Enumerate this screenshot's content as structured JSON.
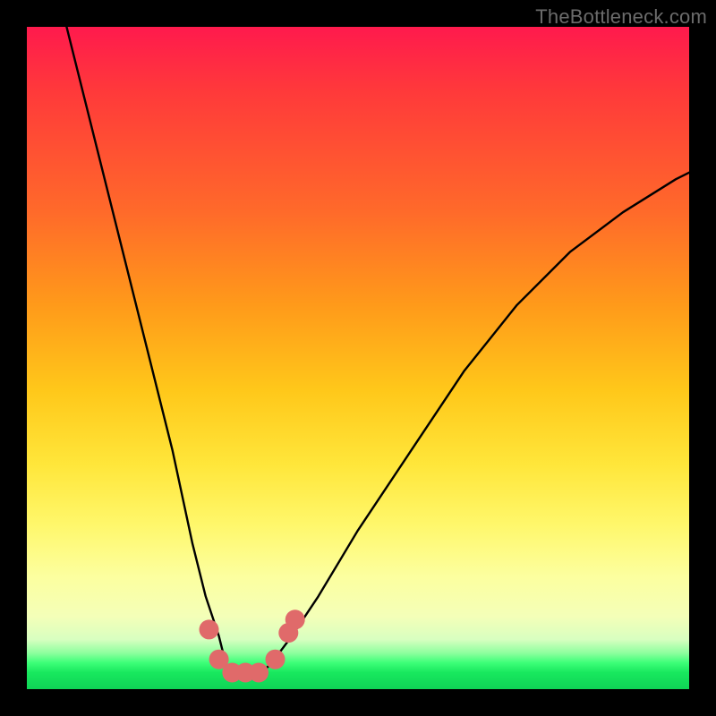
{
  "watermark": "TheBottleneck.com",
  "chart_data": {
    "type": "line",
    "title": "",
    "xlabel": "",
    "ylabel": "",
    "xlim": [
      0,
      100
    ],
    "ylim": [
      0,
      100
    ],
    "grid": false,
    "legend": false,
    "series": [
      {
        "name": "curve",
        "x": [
          6,
          10,
          14,
          18,
          22,
          25,
          27,
          29,
          30,
          31,
          32,
          33,
          35,
          37,
          40,
          44,
          50,
          58,
          66,
          74,
          82,
          90,
          98,
          100
        ],
        "y": [
          100,
          84,
          68,
          52,
          36,
          22,
          14,
          8,
          4,
          2,
          2,
          2,
          2,
          4,
          8,
          14,
          24,
          36,
          48,
          58,
          66,
          72,
          77,
          78
        ]
      }
    ],
    "markers": [
      {
        "name": "left-upper-marker",
        "x": 27.5,
        "y": 9
      },
      {
        "name": "left-lower-marker",
        "x": 29.0,
        "y": 4.5
      },
      {
        "name": "trough-marker-1",
        "x": 31.0,
        "y": 2.5
      },
      {
        "name": "trough-marker-2",
        "x": 33.0,
        "y": 2.5
      },
      {
        "name": "trough-marker-3",
        "x": 35.0,
        "y": 2.5
      },
      {
        "name": "right-lower-marker",
        "x": 37.5,
        "y": 4.5
      },
      {
        "name": "right-upper-marker",
        "x": 39.5,
        "y": 8.5
      },
      {
        "name": "right-upper2-marker",
        "x": 40.5,
        "y": 10.5
      }
    ],
    "colors": {
      "curve": "#000000",
      "markers": "#e06a6a",
      "gradient_top": "#ff1a4d",
      "gradient_mid": "#ffe63a",
      "gradient_bottom": "#0fd456"
    }
  }
}
